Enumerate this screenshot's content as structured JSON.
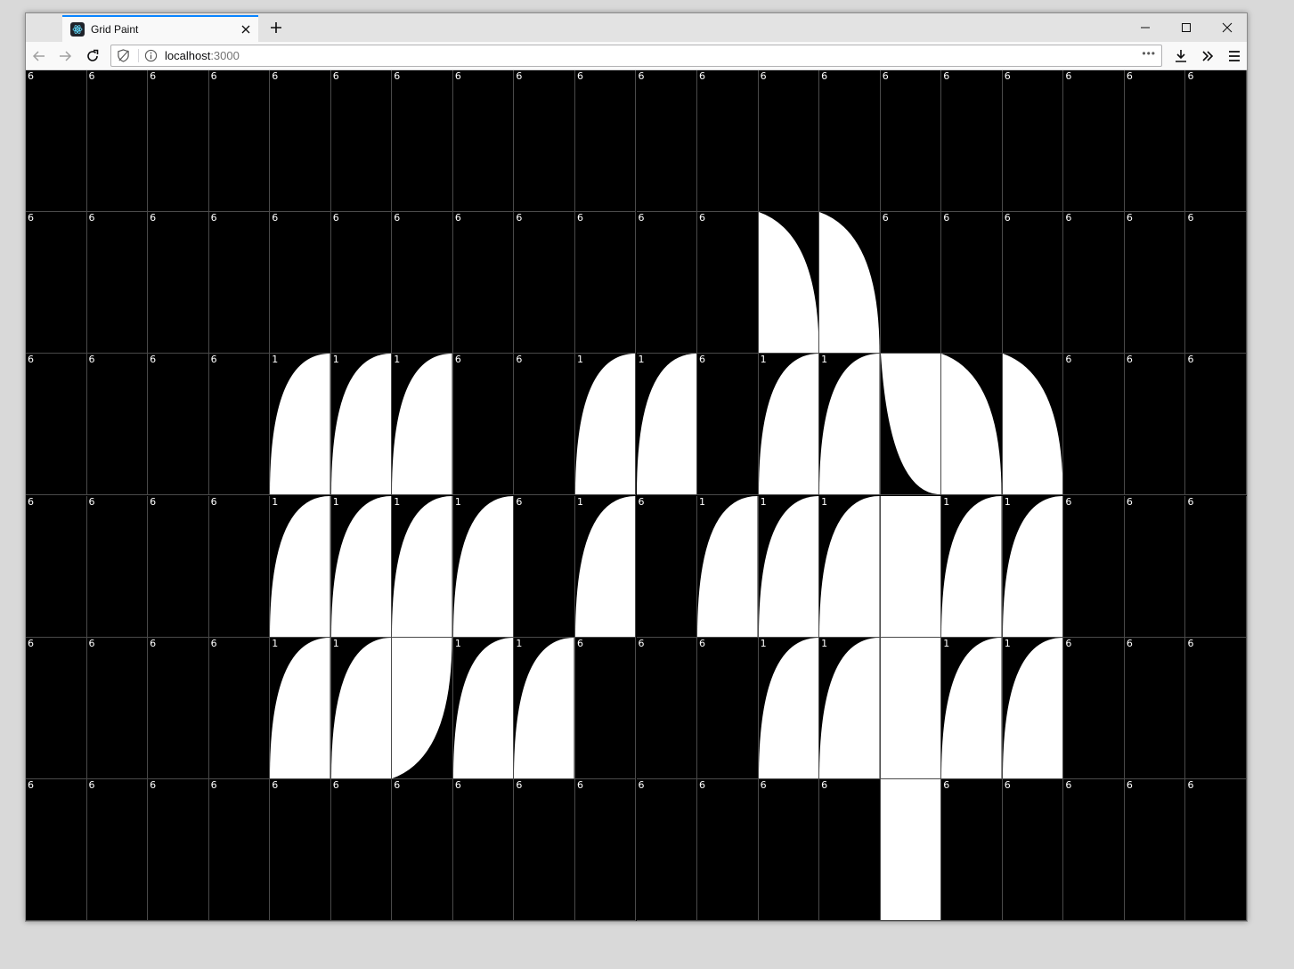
{
  "browser": {
    "tab_title": "Grid Paint",
    "tab_favicon": "react-atom-icon",
    "url_host": "localhost",
    "url_port": ":3000",
    "url_icons": [
      "tracking-protection-icon",
      "info-icon"
    ],
    "url_menu": "•••",
    "toolbar_icons": [
      "back-arrow-icon",
      "forward-arrow-icon",
      "reload-icon",
      "download-icon",
      "overflow-chevron-icon",
      "hamburger-menu-icon"
    ],
    "window_controls": [
      "minimize-icon",
      "maximize-icon",
      "close-icon"
    ]
  },
  "grid": {
    "columns": 20,
    "rows": 6,
    "colors": {
      "on": "#ffffff",
      "off": "#000000",
      "line": "#4a4a4a"
    },
    "shape_legend": {
      "0": "empty",
      "1": "arc-rise",
      "2": "arc-drop-top-left",
      "3": "arc-drop-bottom-left",
      "4": "full",
      "5": "arc-drop-bottom-right"
    },
    "cells": [
      [
        {
          "s": 0,
          "l": "6"
        },
        {
          "s": 0,
          "l": "6"
        },
        {
          "s": 0,
          "l": "6"
        },
        {
          "s": 0,
          "l": "6"
        },
        {
          "s": 0,
          "l": "6"
        },
        {
          "s": 0,
          "l": "6"
        },
        {
          "s": 0,
          "l": "6"
        },
        {
          "s": 0,
          "l": "6"
        },
        {
          "s": 0,
          "l": "6"
        },
        {
          "s": 0,
          "l": "6"
        },
        {
          "s": 0,
          "l": "6"
        },
        {
          "s": 0,
          "l": "6"
        },
        {
          "s": 0,
          "l": "6"
        },
        {
          "s": 0,
          "l": "6"
        },
        {
          "s": 0,
          "l": "6"
        },
        {
          "s": 0,
          "l": "6"
        },
        {
          "s": 0,
          "l": "6"
        },
        {
          "s": 0,
          "l": "6"
        },
        {
          "s": 0,
          "l": "6"
        },
        {
          "s": 0,
          "l": "6"
        }
      ],
      [
        {
          "s": 0,
          "l": "6"
        },
        {
          "s": 0,
          "l": "6"
        },
        {
          "s": 0,
          "l": "6"
        },
        {
          "s": 0,
          "l": "6"
        },
        {
          "s": 0,
          "l": "6"
        },
        {
          "s": 0,
          "l": "6"
        },
        {
          "s": 0,
          "l": "6"
        },
        {
          "s": 0,
          "l": "6"
        },
        {
          "s": 0,
          "l": "6"
        },
        {
          "s": 0,
          "l": "6"
        },
        {
          "s": 0,
          "l": "6"
        },
        {
          "s": 0,
          "l": "6"
        },
        {
          "s": 2,
          "l": ""
        },
        {
          "s": 2,
          "l": ""
        },
        {
          "s": 0,
          "l": "6"
        },
        {
          "s": 0,
          "l": "6"
        },
        {
          "s": 0,
          "l": "6"
        },
        {
          "s": 0,
          "l": "6"
        },
        {
          "s": 0,
          "l": "6"
        },
        {
          "s": 0,
          "l": "6"
        }
      ],
      [
        {
          "s": 0,
          "l": "6"
        },
        {
          "s": 0,
          "l": "6"
        },
        {
          "s": 0,
          "l": "6"
        },
        {
          "s": 0,
          "l": "6"
        },
        {
          "s": 1,
          "l": "1"
        },
        {
          "s": 1,
          "l": "1"
        },
        {
          "s": 1,
          "l": "1"
        },
        {
          "s": 0,
          "l": "6"
        },
        {
          "s": 0,
          "l": "6"
        },
        {
          "s": 1,
          "l": "1"
        },
        {
          "s": 1,
          "l": "1"
        },
        {
          "s": 0,
          "l": "6"
        },
        {
          "s": 1,
          "l": "1"
        },
        {
          "s": 1,
          "l": "1"
        },
        {
          "s": 3,
          "l": ""
        },
        {
          "s": 2,
          "l": ""
        },
        {
          "s": 2,
          "l": ""
        },
        {
          "s": 0,
          "l": "6"
        },
        {
          "s": 0,
          "l": "6"
        },
        {
          "s": 0,
          "l": "6"
        }
      ],
      [
        {
          "s": 0,
          "l": "6"
        },
        {
          "s": 0,
          "l": "6"
        },
        {
          "s": 0,
          "l": "6"
        },
        {
          "s": 0,
          "l": "6"
        },
        {
          "s": 1,
          "l": "1"
        },
        {
          "s": 1,
          "l": "1"
        },
        {
          "s": 1,
          "l": "1"
        },
        {
          "s": 1,
          "l": "1"
        },
        {
          "s": 0,
          "l": "6"
        },
        {
          "s": 1,
          "l": "1"
        },
        {
          "s": 0,
          "l": "6"
        },
        {
          "s": 1,
          "l": "1"
        },
        {
          "s": 1,
          "l": "1"
        },
        {
          "s": 1,
          "l": "1"
        },
        {
          "s": 4,
          "l": ""
        },
        {
          "s": 1,
          "l": "1"
        },
        {
          "s": 1,
          "l": "1"
        },
        {
          "s": 0,
          "l": "6"
        },
        {
          "s": 0,
          "l": "6"
        },
        {
          "s": 0,
          "l": "6"
        }
      ],
      [
        {
          "s": 0,
          "l": "6"
        },
        {
          "s": 0,
          "l": "6"
        },
        {
          "s": 0,
          "l": "6"
        },
        {
          "s": 0,
          "l": "6"
        },
        {
          "s": 1,
          "l": "1"
        },
        {
          "s": 1,
          "l": "1"
        },
        {
          "s": 5,
          "l": ""
        },
        {
          "s": 1,
          "l": "1"
        },
        {
          "s": 1,
          "l": "1"
        },
        {
          "s": 0,
          "l": "6"
        },
        {
          "s": 0,
          "l": "6"
        },
        {
          "s": 0,
          "l": "6"
        },
        {
          "s": 1,
          "l": "1"
        },
        {
          "s": 1,
          "l": "1"
        },
        {
          "s": 4,
          "l": ""
        },
        {
          "s": 1,
          "l": "1"
        },
        {
          "s": 1,
          "l": "1"
        },
        {
          "s": 0,
          "l": "6"
        },
        {
          "s": 0,
          "l": "6"
        },
        {
          "s": 0,
          "l": "6"
        }
      ],
      [
        {
          "s": 0,
          "l": "6"
        },
        {
          "s": 0,
          "l": "6"
        },
        {
          "s": 0,
          "l": "6"
        },
        {
          "s": 0,
          "l": "6"
        },
        {
          "s": 0,
          "l": "6"
        },
        {
          "s": 0,
          "l": "6"
        },
        {
          "s": 0,
          "l": "6"
        },
        {
          "s": 0,
          "l": "6"
        },
        {
          "s": 0,
          "l": "6"
        },
        {
          "s": 0,
          "l": "6"
        },
        {
          "s": 0,
          "l": "6"
        },
        {
          "s": 0,
          "l": "6"
        },
        {
          "s": 0,
          "l": "6"
        },
        {
          "s": 0,
          "l": "6"
        },
        {
          "s": 4,
          "l": ""
        },
        {
          "s": 0,
          "l": "6"
        },
        {
          "s": 0,
          "l": "6"
        },
        {
          "s": 0,
          "l": "6"
        },
        {
          "s": 0,
          "l": "6"
        },
        {
          "s": 0,
          "l": "6"
        }
      ]
    ]
  }
}
